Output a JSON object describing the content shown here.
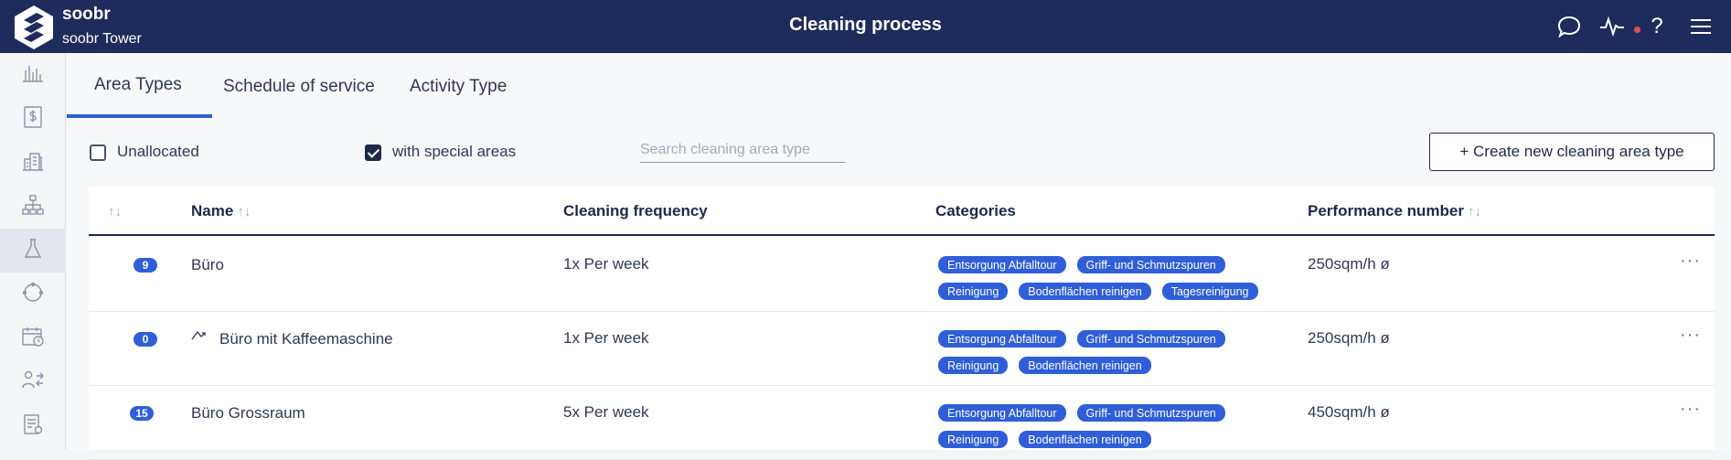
{
  "header": {
    "brand_name": "soobr",
    "brand_sub": "soobr Tower",
    "title": "Cleaning process",
    "icons": [
      "chat-icon",
      "activity-icon",
      "help-icon",
      "menu-icon"
    ],
    "help_glyph": "?"
  },
  "sidebar": {
    "items": [
      {
        "icon": "bar-chart-icon"
      },
      {
        "icon": "invoice-dollar-icon"
      },
      {
        "icon": "buildings-icon"
      },
      {
        "icon": "org-tree-icon"
      },
      {
        "icon": "flask-icon",
        "active": true
      },
      {
        "icon": "cycle-icon"
      },
      {
        "icon": "calendar-clock-icon"
      },
      {
        "icon": "users-swap-icon"
      },
      {
        "icon": "document-list-icon"
      }
    ]
  },
  "tabs": [
    {
      "label": "Area Types",
      "active": true
    },
    {
      "label": "Schedule of service"
    },
    {
      "label": "Activity Type"
    }
  ],
  "filters": {
    "unallocated_label": "Unallocated",
    "unallocated_checked": false,
    "special_label": "with special areas",
    "special_checked": true,
    "search_placeholder": "Search cleaning area type",
    "create_label": "+ Create new cleaning area type"
  },
  "table": {
    "columns": {
      "sort": "↑↓",
      "name": "Name",
      "frequency": "Cleaning frequency",
      "categories": "Categories",
      "performance": "Performance number"
    },
    "rows": [
      {
        "count": "9",
        "name": "Büro",
        "has_icon": false,
        "frequency": "1x Per week",
        "categories": [
          "Entsorgung Abfalltour",
          "Griff- und Schmutzspuren",
          "Reinigung",
          "Bodenflächen reinigen",
          "Tagesreinigung"
        ],
        "performance": "250sqm/h ø"
      },
      {
        "count": "0",
        "name": "Büro mit Kaffeemaschine",
        "has_icon": true,
        "frequency": "1x Per week",
        "categories": [
          "Entsorgung Abfalltour",
          "Griff- und Schmutzspuren",
          "Reinigung",
          "Bodenflächen reinigen"
        ],
        "performance": "250sqm/h ø"
      },
      {
        "count": "15",
        "name": "Büro Grossraum",
        "has_icon": false,
        "frequency": "5x Per week",
        "categories": [
          "Entsorgung Abfalltour",
          "Griff- und Schmutzspuren",
          "Reinigung",
          "Bodenflächen reinigen"
        ],
        "performance": "450sqm/h ø"
      }
    ],
    "more_glyph": "···"
  },
  "colors": {
    "header_bg": "#1e2c5b",
    "accent": "#2f5ed8",
    "alert_dot": "#e84a5f"
  }
}
